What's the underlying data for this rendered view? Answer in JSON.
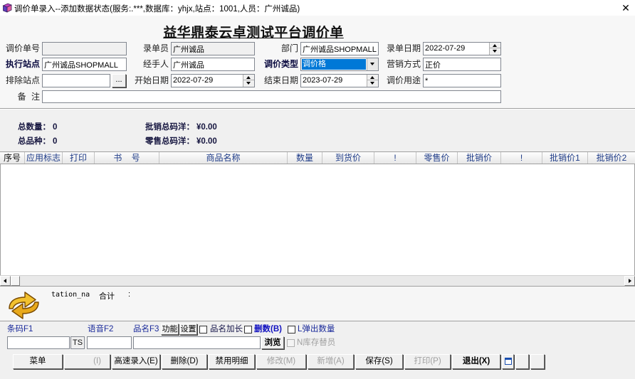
{
  "window": {
    "title": "调价单录入--添加数据状态(服务:.***,数据库：yhjx,站点：1001,人员：广州诚品)",
    "close_label": "✕",
    "app_icon": "book-icon"
  },
  "header": {
    "title": "益华鼎泰云卓测试平台调价单"
  },
  "form": {
    "order_no": {
      "label": "调价单号",
      "value": ""
    },
    "recorder": {
      "label": "录单员",
      "value": "广州诚品"
    },
    "department": {
      "label": "部门",
      "value": "广州诚品SHOPMALL"
    },
    "record_date": {
      "label": "录单日期",
      "value": "2022-07-29"
    },
    "exec_site": {
      "label": "执行站点",
      "value": "广州诚品SHOPMALL"
    },
    "handler": {
      "label": "经手人",
      "value": "广州诚品"
    },
    "adjust_type": {
      "label": "调价类型",
      "value": "调价格"
    },
    "sales_mode": {
      "label": "营销方式",
      "value": "正价"
    },
    "exclude_site": {
      "label": "排除站点",
      "value": "",
      "browse_label": "..."
    },
    "start_date": {
      "label": "开始日期",
      "value": "2022-07-29"
    },
    "end_date": {
      "label": "结束日期",
      "value": "2023-07-29"
    },
    "purpose": {
      "label": "调价用途",
      "value": "*"
    },
    "remark": {
      "label": "备 注",
      "value": ""
    }
  },
  "summary": {
    "total_qty_label": "总数量：",
    "total_qty": "0",
    "total_kinds_label": "总品种：",
    "total_kinds": "0",
    "wholesale_label": "批销总码洋：",
    "wholesale": "¥0.00",
    "retail_label": "零售总码洋：",
    "retail": "¥0.00"
  },
  "table": {
    "columns": [
      "序号",
      "应用标志",
      "打印",
      "书 号",
      "商品名称",
      "数量",
      "到货价",
      "!",
      "零售价",
      "批销价",
      "!",
      "批销价1",
      "批销价2"
    ],
    "rows": []
  },
  "total_panel": {
    "icon": "refresh-arrows-icon",
    "field_name": "tation_na",
    "total_label": "合计",
    "total_sep": ":"
  },
  "entry_bar": {
    "barcode_label": "条码F1",
    "voice_label": "语音F2",
    "name_label": "品名F3",
    "function_button": "功能",
    "settings_button": "设置",
    "long_name": {
      "label": "品名加长",
      "checked": false
    },
    "delete_qty": {
      "label": "删数(B)",
      "checked": false
    },
    "popup_qty": {
      "label": "L弹出数量",
      "checked": false
    },
    "barcode_value": "",
    "ts_label": "TS",
    "voice_value": "",
    "name_value": "",
    "browse_button": "浏览",
    "stock_replace": {
      "label": "N库存替员",
      "checked": false,
      "disabled": true
    }
  },
  "buttons": [
    {
      "label": "菜单",
      "disabled": false
    },
    {
      "label": "(I)",
      "disabled": true
    },
    {
      "label": "高速录入(E)",
      "disabled": false
    },
    {
      "label": "删除(D)",
      "disabled": false
    },
    {
      "label": "禁用明细",
      "disabled": false
    },
    {
      "label": "修改(M)",
      "disabled": true
    },
    {
      "label": "新增(A)",
      "disabled": true
    },
    {
      "label": "保存(S)",
      "disabled": false
    },
    {
      "label": "打印(P)",
      "disabled": true
    },
    {
      "label": "退出(X)",
      "disabled": false
    },
    {
      "label": "",
      "icon": "window-icon"
    },
    {
      "label": ""
    },
    {
      "label": ""
    }
  ],
  "colors": {
    "background": "#f0f0f0",
    "selection": "#0078d7",
    "label_blue": "#1a2a9a",
    "column_header_text": "#1f3c88",
    "disabled_text": "#a0a0a0"
  }
}
